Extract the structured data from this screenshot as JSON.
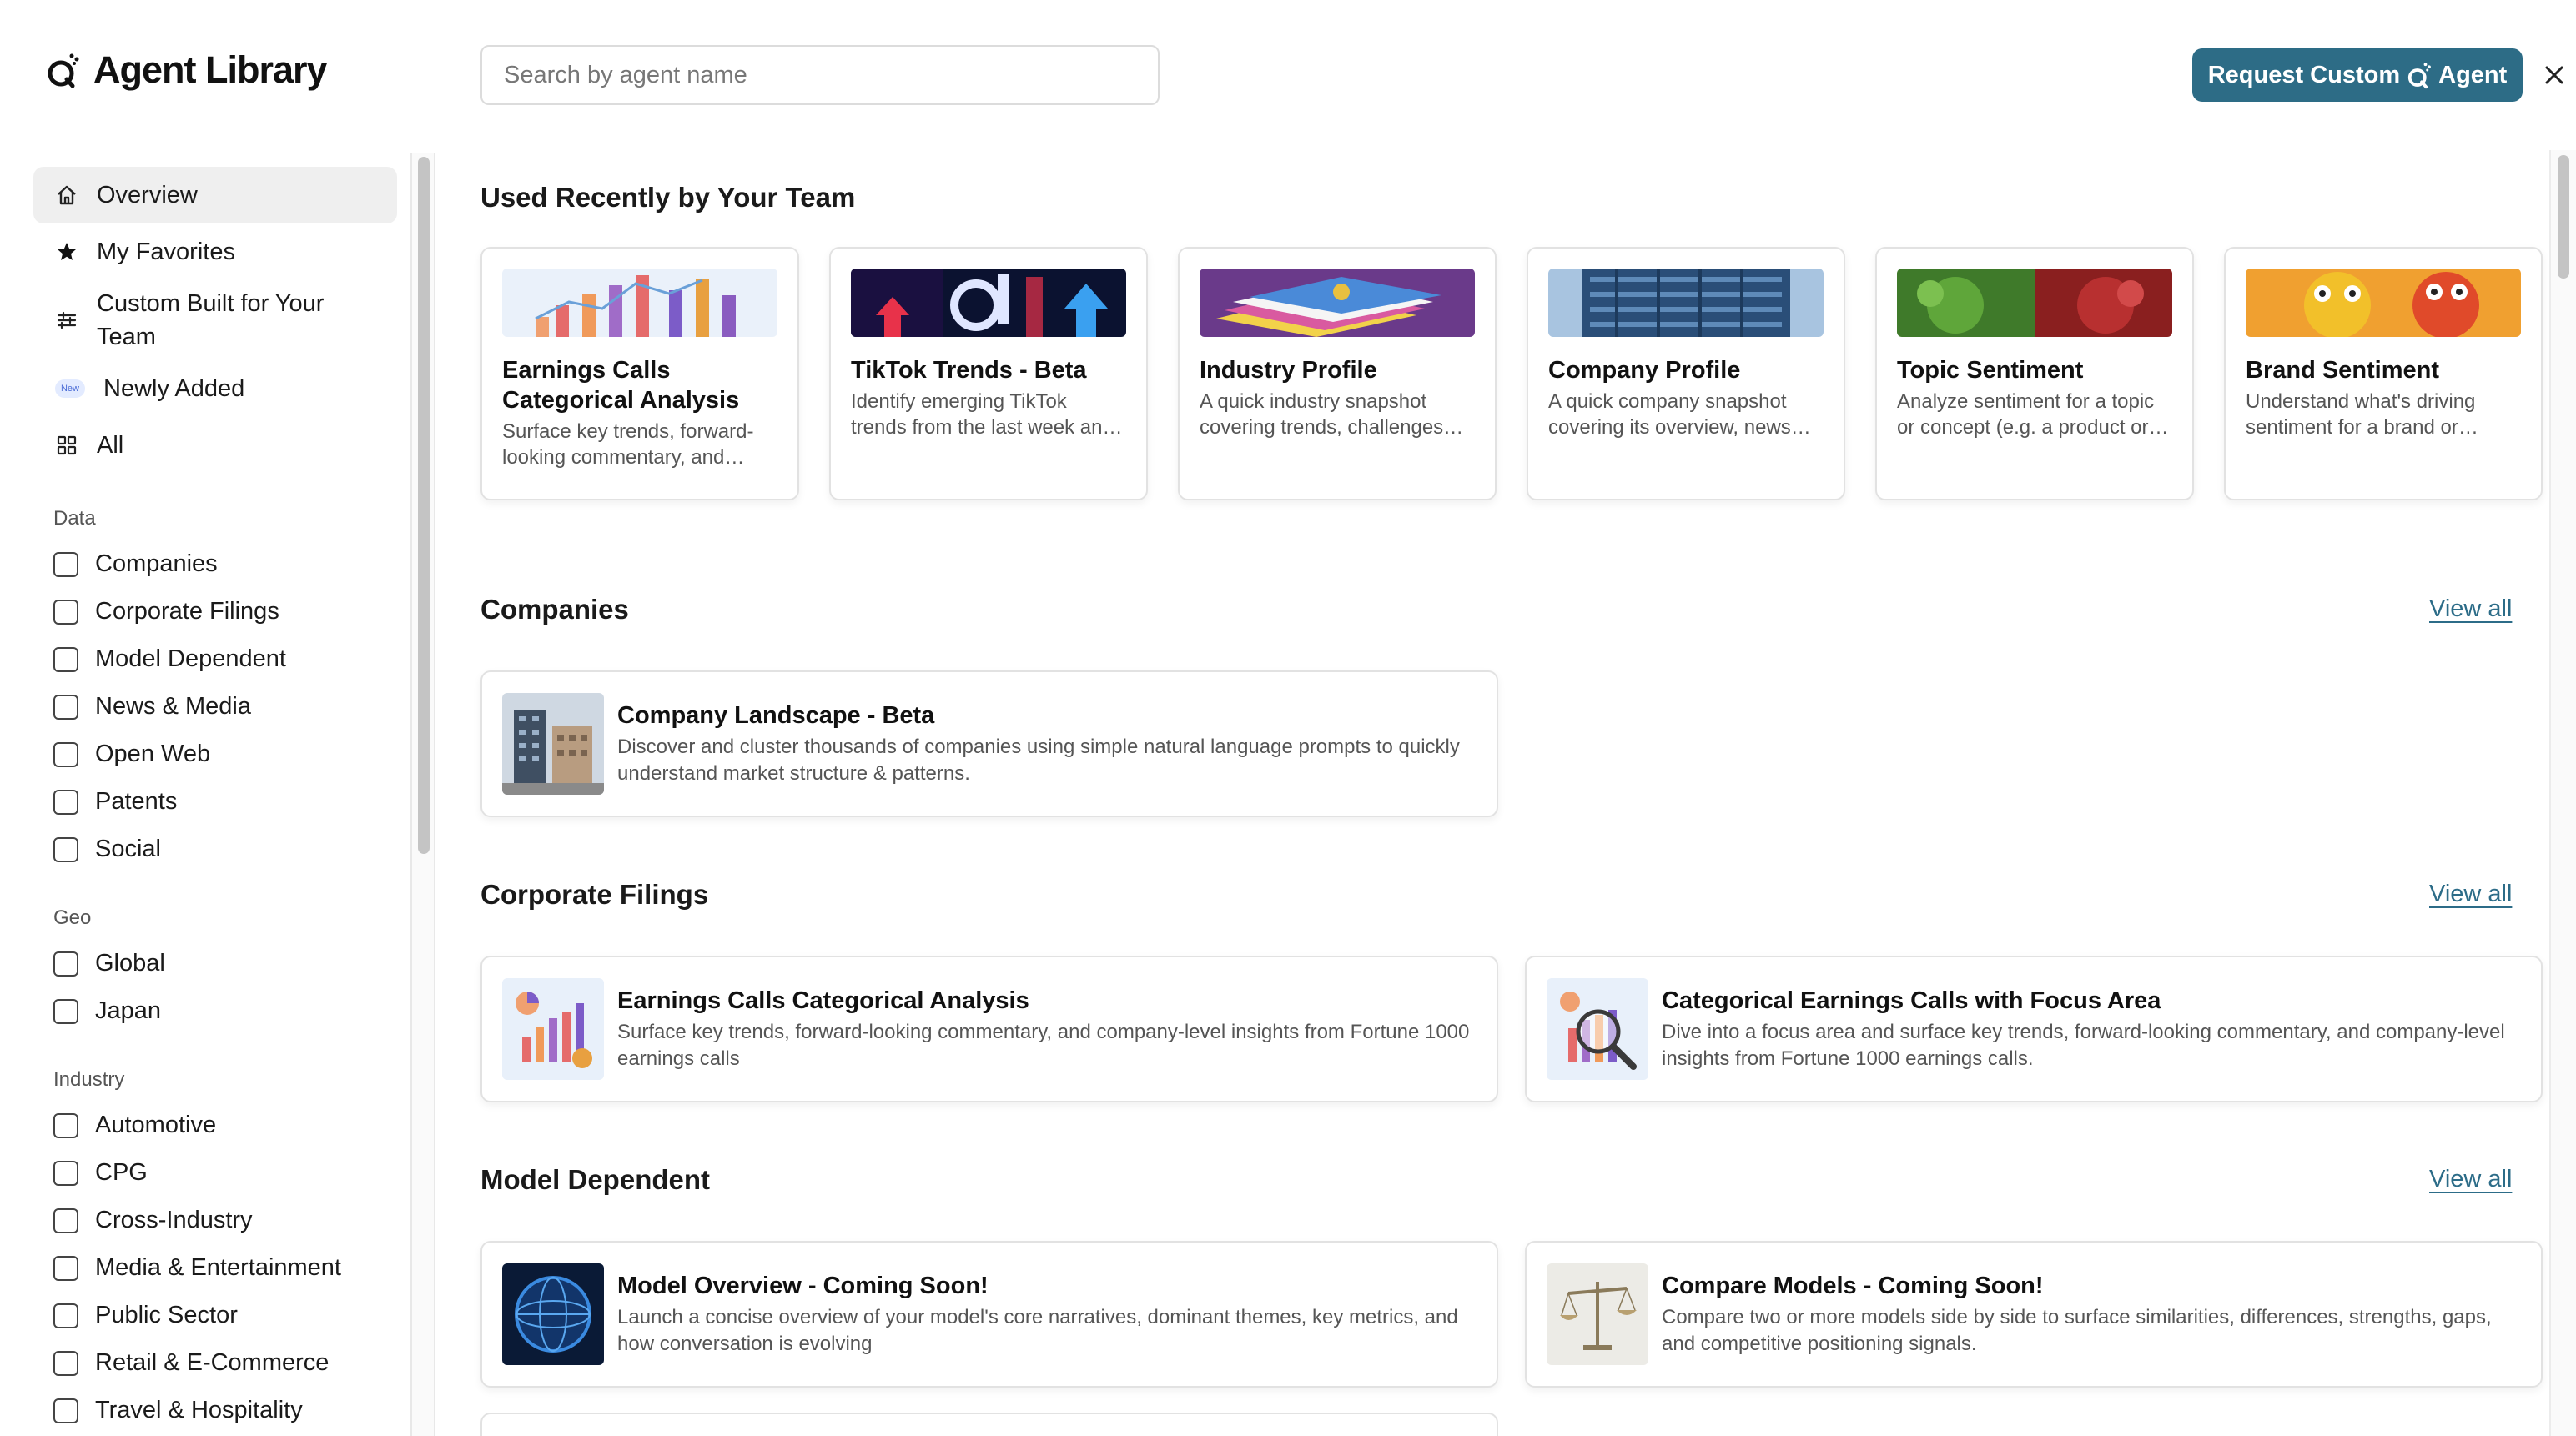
{
  "header": {
    "app_title": "Agent Library",
    "search_placeholder": "Search by agent name",
    "request_label_pre": "Request Custom",
    "request_label_post": "Agent"
  },
  "sidebar": {
    "nav": [
      {
        "label": "Overview",
        "icon": "home-icon",
        "active": true
      },
      {
        "label": "My Favorites",
        "icon": "star-icon"
      },
      {
        "label": "Custom Built for Your Team",
        "icon": "sliders-icon"
      },
      {
        "label": "Newly Added",
        "icon": "new-badge-icon",
        "badge": "New"
      },
      {
        "label": "All",
        "icon": "grid-icon"
      }
    ],
    "filters": [
      {
        "heading": "Data",
        "options": [
          "Companies",
          "Corporate Filings",
          "Model Dependent",
          "News & Media",
          "Open Web",
          "Patents",
          "Social"
        ]
      },
      {
        "heading": "Geo",
        "options": [
          "Global",
          "Japan"
        ]
      },
      {
        "heading": "Industry",
        "options": [
          "Automotive",
          "CPG",
          "Cross-Industry",
          "Media & Entertainment",
          "Public Sector",
          "Retail & E-Commerce",
          "Travel & Hospitality"
        ]
      }
    ]
  },
  "main": {
    "recent_title": "Used Recently by Your Team",
    "recent_cards": [
      {
        "title": "Earnings Calls Categorical Analysis",
        "desc": "Surface key trends, forward-looking commentary, and company-level insights"
      },
      {
        "title": "TikTok Trends - Beta",
        "desc": "Identify emerging TikTok trends from the last week and what is driving them"
      },
      {
        "title": "Industry Profile",
        "desc": "A quick industry snapshot covering trends, challenges and opportunities"
      },
      {
        "title": "Company Profile",
        "desc": "A quick company snapshot covering its overview, news and sentiment"
      },
      {
        "title": "Topic Sentiment",
        "desc": "Analyze sentiment for a topic or concept (e.g. a product or campaign)"
      },
      {
        "title": "Brand Sentiment",
        "desc": "Understand what's driving sentiment for a brand or product"
      }
    ],
    "view_all": "View all",
    "sections": [
      {
        "title": "Companies",
        "cards": [
          {
            "title": "Company Landscape - Beta",
            "desc": "Discover and cluster thousands of companies using simple natural language prompts to quickly understand market structure & patterns."
          }
        ]
      },
      {
        "title": "Corporate Filings",
        "cards": [
          {
            "title": "Earnings Calls Categorical Analysis",
            "desc": "Surface key trends, forward-looking commentary, and company-level insights from Fortune 1000 earnings calls"
          },
          {
            "title": "Categorical Earnings Calls with Focus Area",
            "desc": "Dive into a focus area and surface key trends, forward-looking commentary, and company-level insights from Fortune 1000 earnings calls."
          }
        ]
      },
      {
        "title": "Model Dependent",
        "cards": [
          {
            "title": "Model Overview - Coming Soon!",
            "desc": "Launch a concise overview of your model's core narratives, dominant themes, key metrics, and how conversation is evolving"
          },
          {
            "title": "Compare Models - Coming Soon!",
            "desc": "Compare two or more models side by side to surface similarities, differences, strengths, gaps, and competitive positioning signals."
          }
        ]
      }
    ]
  },
  "colors": {
    "accent": "#2d6c86",
    "link": "#2c6c88",
    "active_nav_bg": "#efefef"
  }
}
